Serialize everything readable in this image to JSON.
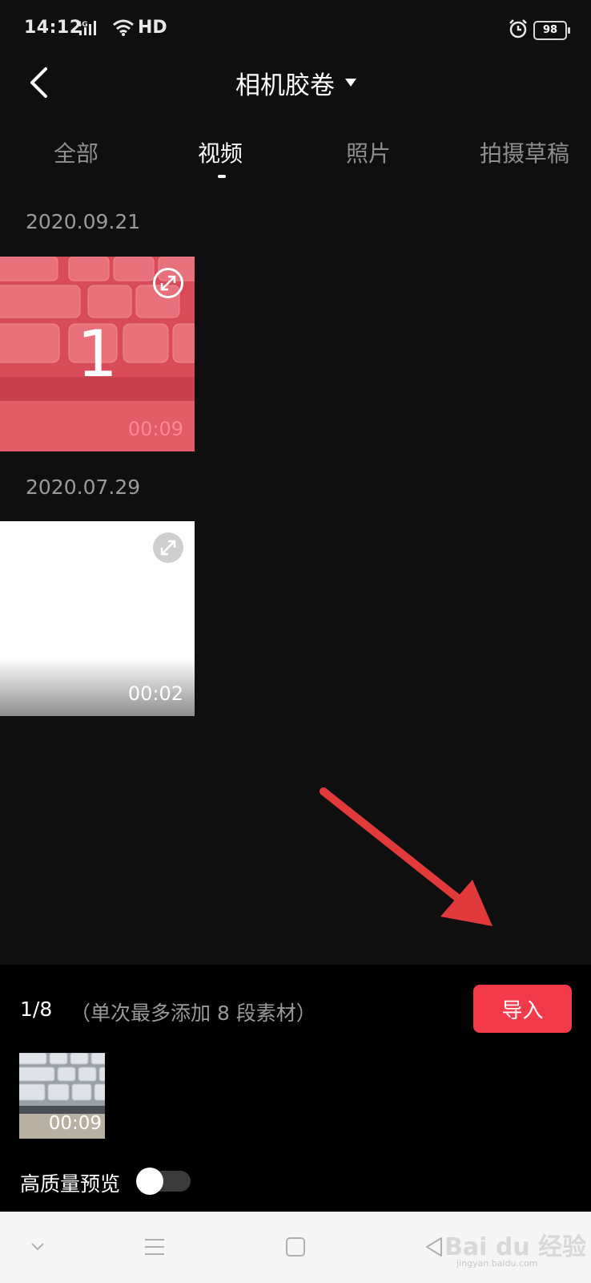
{
  "status_bar": {
    "time": "14:12",
    "network": "4G",
    "hd": "HD",
    "battery": "98"
  },
  "header": {
    "title": "相机胶卷"
  },
  "tabs": [
    {
      "label": "全部",
      "active": false
    },
    {
      "label": "视频",
      "active": true
    },
    {
      "label": "照片",
      "active": false
    },
    {
      "label": "拍摄草稿",
      "active": false
    }
  ],
  "groups": [
    {
      "date": "2020.09.21",
      "items": [
        {
          "duration": "00:09",
          "selected_index": "1"
        }
      ]
    },
    {
      "date": "2020.07.29",
      "items": [
        {
          "duration": "00:02"
        }
      ]
    }
  ],
  "selection": {
    "count": "1/8",
    "hint": "（单次最多添加 8 段素材）",
    "import_label": "导入",
    "items": [
      {
        "duration": "00:09"
      }
    ]
  },
  "hq_preview": {
    "label": "高质量预览",
    "enabled": false
  },
  "watermark": {
    "brand": "Bai du 经验",
    "url": "jingyan.baidu.com"
  },
  "colors": {
    "accent": "#f23a4a",
    "background": "#0f0f0f",
    "panel": "#000000"
  }
}
